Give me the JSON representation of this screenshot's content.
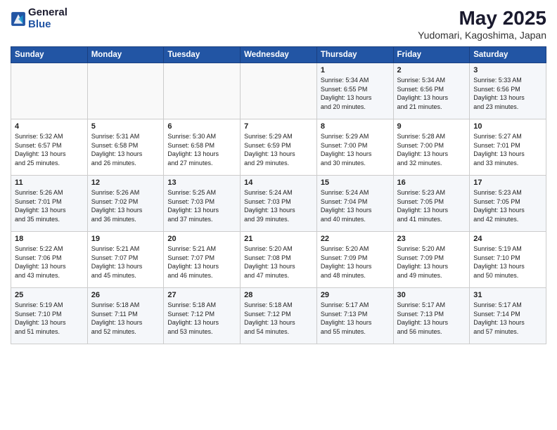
{
  "header": {
    "logo_general": "General",
    "logo_blue": "Blue",
    "month_year": "May 2025",
    "location": "Yudomari, Kagoshima, Japan"
  },
  "days_of_week": [
    "Sunday",
    "Monday",
    "Tuesday",
    "Wednesday",
    "Thursday",
    "Friday",
    "Saturday"
  ],
  "weeks": [
    [
      {
        "day": "",
        "info": ""
      },
      {
        "day": "",
        "info": ""
      },
      {
        "day": "",
        "info": ""
      },
      {
        "day": "",
        "info": ""
      },
      {
        "day": "1",
        "info": "Sunrise: 5:34 AM\nSunset: 6:55 PM\nDaylight: 13 hours\nand 20 minutes."
      },
      {
        "day": "2",
        "info": "Sunrise: 5:34 AM\nSunset: 6:56 PM\nDaylight: 13 hours\nand 21 minutes."
      },
      {
        "day": "3",
        "info": "Sunrise: 5:33 AM\nSunset: 6:56 PM\nDaylight: 13 hours\nand 23 minutes."
      }
    ],
    [
      {
        "day": "4",
        "info": "Sunrise: 5:32 AM\nSunset: 6:57 PM\nDaylight: 13 hours\nand 25 minutes."
      },
      {
        "day": "5",
        "info": "Sunrise: 5:31 AM\nSunset: 6:58 PM\nDaylight: 13 hours\nand 26 minutes."
      },
      {
        "day": "6",
        "info": "Sunrise: 5:30 AM\nSunset: 6:58 PM\nDaylight: 13 hours\nand 27 minutes."
      },
      {
        "day": "7",
        "info": "Sunrise: 5:29 AM\nSunset: 6:59 PM\nDaylight: 13 hours\nand 29 minutes."
      },
      {
        "day": "8",
        "info": "Sunrise: 5:29 AM\nSunset: 7:00 PM\nDaylight: 13 hours\nand 30 minutes."
      },
      {
        "day": "9",
        "info": "Sunrise: 5:28 AM\nSunset: 7:00 PM\nDaylight: 13 hours\nand 32 minutes."
      },
      {
        "day": "10",
        "info": "Sunrise: 5:27 AM\nSunset: 7:01 PM\nDaylight: 13 hours\nand 33 minutes."
      }
    ],
    [
      {
        "day": "11",
        "info": "Sunrise: 5:26 AM\nSunset: 7:01 PM\nDaylight: 13 hours\nand 35 minutes."
      },
      {
        "day": "12",
        "info": "Sunrise: 5:26 AM\nSunset: 7:02 PM\nDaylight: 13 hours\nand 36 minutes."
      },
      {
        "day": "13",
        "info": "Sunrise: 5:25 AM\nSunset: 7:03 PM\nDaylight: 13 hours\nand 37 minutes."
      },
      {
        "day": "14",
        "info": "Sunrise: 5:24 AM\nSunset: 7:03 PM\nDaylight: 13 hours\nand 39 minutes."
      },
      {
        "day": "15",
        "info": "Sunrise: 5:24 AM\nSunset: 7:04 PM\nDaylight: 13 hours\nand 40 minutes."
      },
      {
        "day": "16",
        "info": "Sunrise: 5:23 AM\nSunset: 7:05 PM\nDaylight: 13 hours\nand 41 minutes."
      },
      {
        "day": "17",
        "info": "Sunrise: 5:23 AM\nSunset: 7:05 PM\nDaylight: 13 hours\nand 42 minutes."
      }
    ],
    [
      {
        "day": "18",
        "info": "Sunrise: 5:22 AM\nSunset: 7:06 PM\nDaylight: 13 hours\nand 43 minutes."
      },
      {
        "day": "19",
        "info": "Sunrise: 5:21 AM\nSunset: 7:07 PM\nDaylight: 13 hours\nand 45 minutes."
      },
      {
        "day": "20",
        "info": "Sunrise: 5:21 AM\nSunset: 7:07 PM\nDaylight: 13 hours\nand 46 minutes."
      },
      {
        "day": "21",
        "info": "Sunrise: 5:20 AM\nSunset: 7:08 PM\nDaylight: 13 hours\nand 47 minutes."
      },
      {
        "day": "22",
        "info": "Sunrise: 5:20 AM\nSunset: 7:09 PM\nDaylight: 13 hours\nand 48 minutes."
      },
      {
        "day": "23",
        "info": "Sunrise: 5:20 AM\nSunset: 7:09 PM\nDaylight: 13 hours\nand 49 minutes."
      },
      {
        "day": "24",
        "info": "Sunrise: 5:19 AM\nSunset: 7:10 PM\nDaylight: 13 hours\nand 50 minutes."
      }
    ],
    [
      {
        "day": "25",
        "info": "Sunrise: 5:19 AM\nSunset: 7:10 PM\nDaylight: 13 hours\nand 51 minutes."
      },
      {
        "day": "26",
        "info": "Sunrise: 5:18 AM\nSunset: 7:11 PM\nDaylight: 13 hours\nand 52 minutes."
      },
      {
        "day": "27",
        "info": "Sunrise: 5:18 AM\nSunset: 7:12 PM\nDaylight: 13 hours\nand 53 minutes."
      },
      {
        "day": "28",
        "info": "Sunrise: 5:18 AM\nSunset: 7:12 PM\nDaylight: 13 hours\nand 54 minutes."
      },
      {
        "day": "29",
        "info": "Sunrise: 5:17 AM\nSunset: 7:13 PM\nDaylight: 13 hours\nand 55 minutes."
      },
      {
        "day": "30",
        "info": "Sunrise: 5:17 AM\nSunset: 7:13 PM\nDaylight: 13 hours\nand 56 minutes."
      },
      {
        "day": "31",
        "info": "Sunrise: 5:17 AM\nSunset: 7:14 PM\nDaylight: 13 hours\nand 57 minutes."
      }
    ]
  ]
}
